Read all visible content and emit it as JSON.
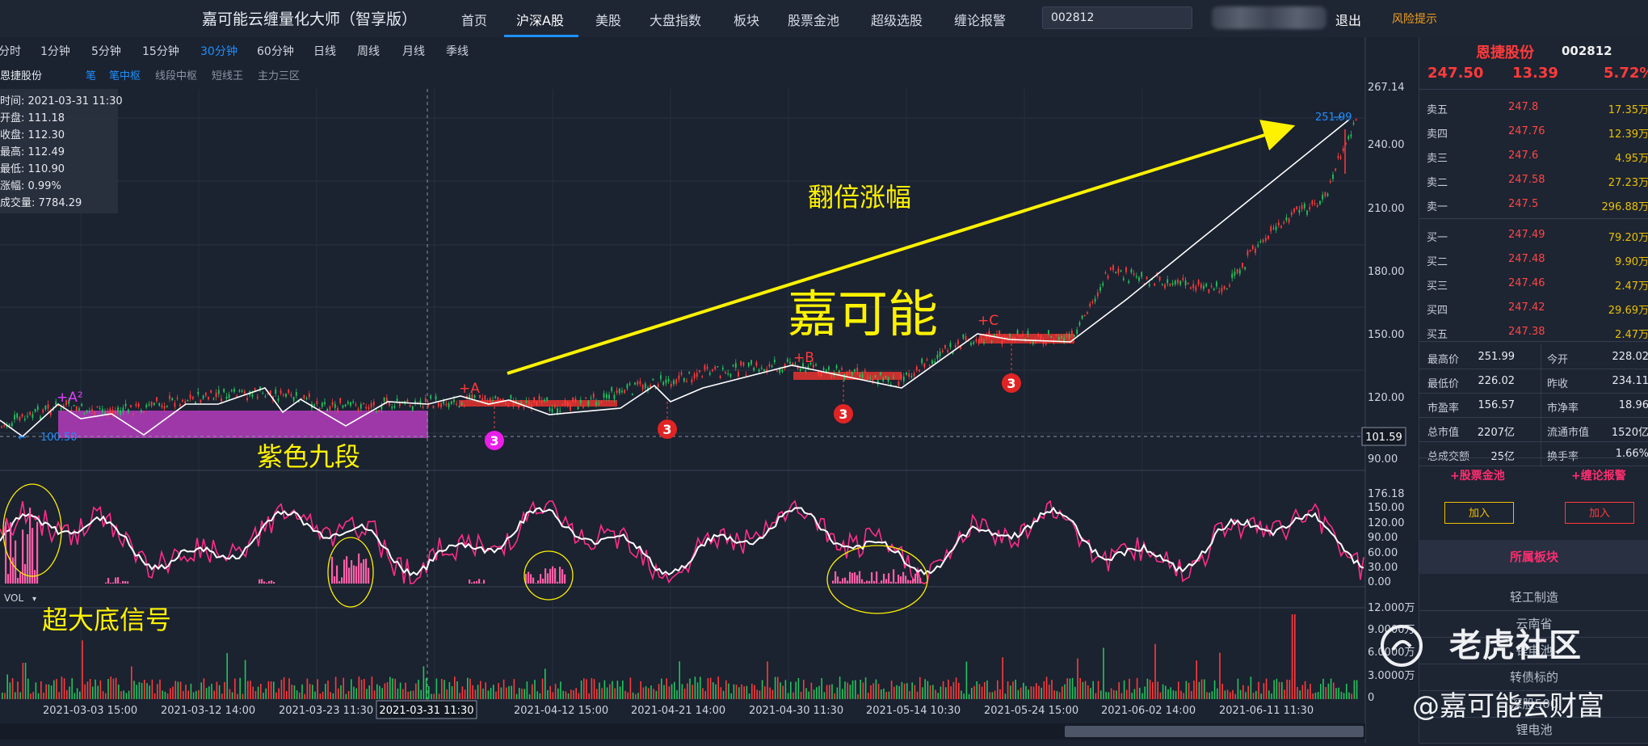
{
  "app": {
    "title": "嘉可能云缠量化大师（智享版）",
    "nav": [
      "首页",
      "沪深A股",
      "美股",
      "大盘指数",
      "板块",
      "股票金池",
      "超级选股",
      "缠论报警"
    ],
    "active_nav": "沪深A股",
    "search_value": "002812",
    "logout": "退出",
    "risk": "风险提示"
  },
  "periods": [
    "分时",
    "1分钟",
    "5分钟",
    "15分钟",
    "30分钟",
    "60分钟",
    "日线",
    "周线",
    "月线",
    "季线"
  ],
  "active_period": "30分钟",
  "indicators": [
    "笔",
    "笔中枢",
    "线段中枢",
    "短线王",
    "主力三区"
  ],
  "info_box": {
    "name": "恩捷股份",
    "rows": [
      "时间:  2021-03-31 11:30",
      "开盘:  111.18",
      "收盘:  112.30",
      "最高:  112.49",
      "最低:  110.90",
      "涨幅:  0.99%",
      "成交量:  7784.29"
    ]
  },
  "price_axis": [
    "267.14",
    "240.00",
    "210.00",
    "180.00",
    "150.00",
    "120.00",
    "90.00"
  ],
  "current_price_tag": "101.59",
  "high_marker": "251.99",
  "low_marker": "100.50",
  "osc_axis": [
    "176.18",
    "150.00",
    "120.00",
    "90.00",
    "60.00",
    "30.00",
    "0.00"
  ],
  "vol_axis": [
    "12.000万",
    "9.0000万",
    "6.0000万",
    "3.0000万",
    "0"
  ],
  "vol_label": "VOL",
  "date_axis": [
    "2021-03-03 15:00",
    "2021-03-12 14:00",
    "2021-03-23 11:30",
    "2021-03-31 11:30",
    "2021-04-12 15:00",
    "2021-04-21 14:00",
    "2021-04-30 11:30",
    "2021-05-14 10:30",
    "2021-05-24 15:00",
    "2021-06-02 14:00",
    "2021-06-11 11:30"
  ],
  "annotations": {
    "A2": "+A²",
    "A": "+A",
    "B": "+B",
    "C": "+C",
    "three": "3",
    "double": "翻倍涨幅",
    "brand": "嘉可能",
    "purple": "紫色九段",
    "bottom": "超大底信号"
  },
  "quote": {
    "name": "恩捷股份",
    "code": "002812",
    "price": "247.50",
    "change": "13.39",
    "pct": "5.72%"
  },
  "order_book": [
    {
      "label": "卖五",
      "price": "247.8",
      "vol": "17.35万"
    },
    {
      "label": "卖四",
      "price": "247.76",
      "vol": "12.39万"
    },
    {
      "label": "卖三",
      "price": "247.6",
      "vol": "4.95万"
    },
    {
      "label": "卖二",
      "price": "247.58",
      "vol": "27.23万"
    },
    {
      "label": "卖一",
      "price": "247.5",
      "vol": "296.88万"
    },
    {
      "label": "买一",
      "price": "247.49",
      "vol": "79.20万"
    },
    {
      "label": "买二",
      "price": "247.48",
      "vol": "9.90万"
    },
    {
      "label": "买三",
      "price": "247.46",
      "vol": "2.47万"
    },
    {
      "label": "买四",
      "price": "247.42",
      "vol": "29.69万"
    },
    {
      "label": "买五",
      "price": "247.38",
      "vol": "2.47万"
    }
  ],
  "stats": [
    {
      "l1": "最高价",
      "v1": "251.99",
      "l2": "今开",
      "v2": "228.02"
    },
    {
      "l1": "最低价",
      "v1": "226.02",
      "l2": "昨收",
      "v2": "234.11"
    },
    {
      "l1": "市盈率",
      "v1": "156.57",
      "l2": "市净率",
      "v2": "18.96"
    },
    {
      "l1": "总市值",
      "v1": "2207亿",
      "l2": "流通市值",
      "v2": "1520亿"
    },
    {
      "l1": "总成交额",
      "v1": "25亿",
      "l2": "换手率",
      "v2": "1.66%"
    }
  ],
  "pool_button": "+股票金池",
  "alert_button": "+缠论报警",
  "add": "加入",
  "section_title": "所属板块",
  "sections": [
    "轻工制造",
    "云南省",
    "锂电池",
    "转债标的",
    "深股500",
    "锂电池"
  ],
  "watermark": "老虎社区",
  "watermark2": "@嘉可能云财富",
  "colors": {
    "up": "#ff3b3b",
    "down": "#22c55e",
    "accent": "#1e90ff",
    "purple": "#a93bb3",
    "yellow": "#fff200",
    "pink": "#ff2d8a"
  }
}
